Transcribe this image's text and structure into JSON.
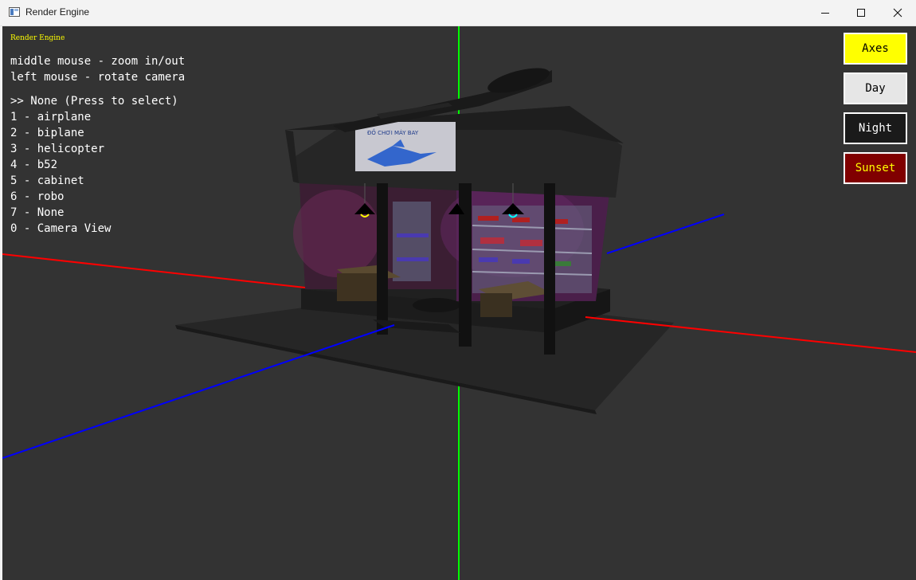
{
  "window": {
    "title": "Render Engine"
  },
  "viewport": {
    "overlay_title": "Render Engine",
    "help_lines": [
      "middle mouse - zoom in/out",
      "left mouse - rotate camera"
    ],
    "selection": {
      "current": ">> None (Press to select)",
      "options": [
        "1 - airplane",
        "2 - biplane",
        "3 - helicopter",
        "4 - b52",
        "5 - cabinet",
        "6 - robo",
        "7 - None",
        "0 - Camera View"
      ]
    },
    "sign_text": "ĐỒ CHƠI MÁY BAY"
  },
  "mode_buttons": [
    {
      "label": "Axes",
      "bg": "#ffff00",
      "fg": "#000000"
    },
    {
      "label": "Day",
      "bg": "#e6e6e6",
      "fg": "#000000"
    },
    {
      "label": "Night",
      "bg": "#1a1a1a",
      "fg": "#ffffff"
    },
    {
      "label": "Sunset",
      "bg": "#800000",
      "fg": "#ffff00"
    }
  ],
  "colors": {
    "background": "#333333",
    "axis_x": "#ff0000",
    "axis_y": "#00ff00",
    "axis_z": "#0000ff"
  }
}
